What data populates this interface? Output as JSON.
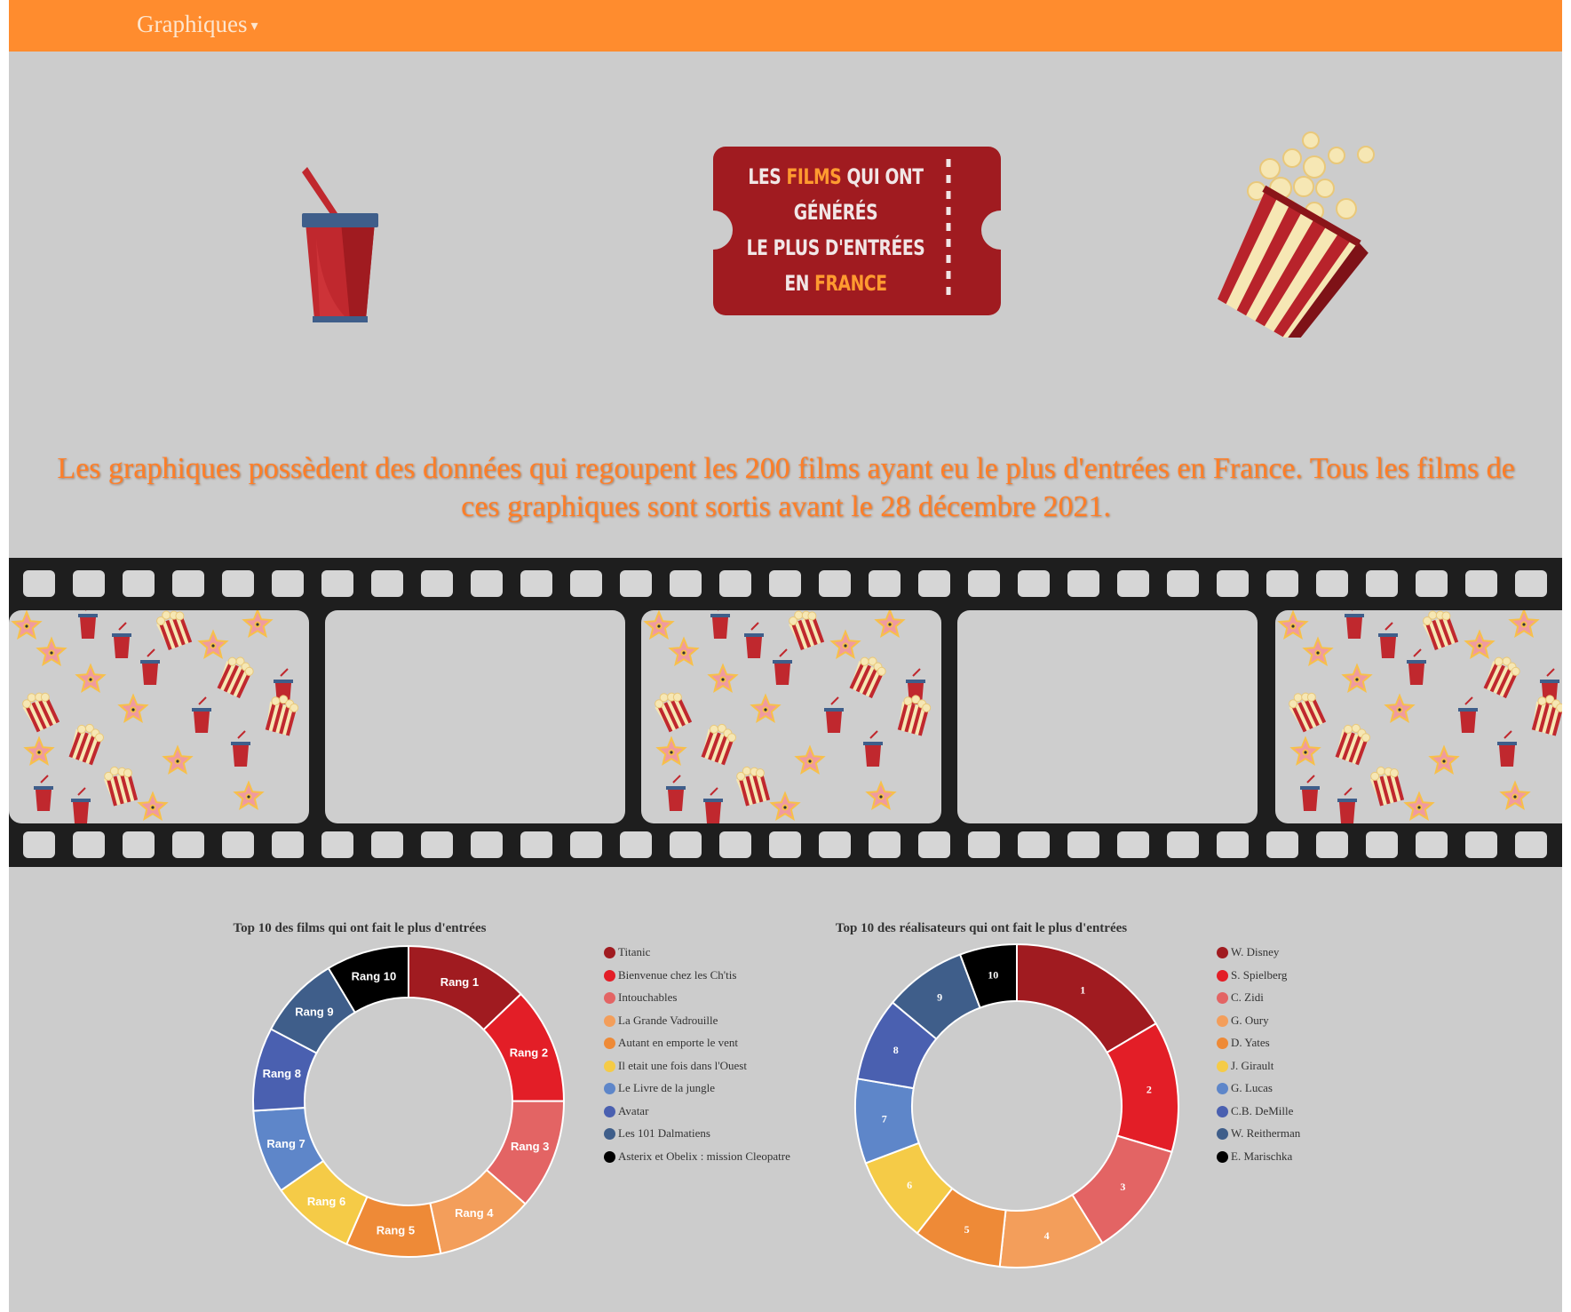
{
  "nav": {
    "menu_label": "Graphiques"
  },
  "ticket": {
    "line1_a": "Les ",
    "line1_hl": "films",
    "line1_b": " qui ont",
    "line2": "générés",
    "line3": "le plus d'entrées",
    "line4_a": "en ",
    "line4_hl": "France"
  },
  "intro": "Les graphiques possèdent des données qui regoupent les 200 films ayant eu le plus d'entrées en France. Tous les films de ces graphiques sont sortis avant le 28 décembre 2021.",
  "colors": {
    "nav": "#ff8c2e",
    "background": "#cccccc",
    "ticket": "#a01b20",
    "highlight": "#ff9b30",
    "palette": [
      "#a01b20",
      "#e31e27",
      "#e36464",
      "#f39e5b",
      "#ee8a37",
      "#f5cb47",
      "#5e86c9",
      "#4a60b0",
      "#3f5e8a",
      "#000000"
    ]
  },
  "chart_data": [
    {
      "type": "pie",
      "title": "Top 10 des films qui ont fait le plus d'entrées",
      "categories": [
        "Titanic",
        "Bienvenue chez les Ch'tis",
        "Intouchables",
        "La Grande Vadrouille",
        "Autant en emporte le vent",
        "Il etait une fois dans l'Ouest",
        "Le Livre de la jungle",
        "Avatar",
        "Les 101 Dalmatiens",
        "Asterix et Obelix : mission Cleopatre"
      ],
      "slice_labels": [
        "Rang 1",
        "Rang 2",
        "Rang 3",
        "Rang 4",
        "Rang 5",
        "Rang 6",
        "Rang 7",
        "Rang 8",
        "Rang 9",
        "Rang 10"
      ],
      "values": [
        21.8,
        20.5,
        19.5,
        17.3,
        16.7,
        14.9,
        14.8,
        14.7,
        14.7,
        14.6
      ],
      "legend_position": "right",
      "donut": true
    },
    {
      "type": "pie",
      "title": "Top 10 des réalisateurs qui ont fait le plus d'entrées",
      "categories": [
        "W. Disney",
        "S. Spielberg",
        "C. Zidi",
        "G. Oury",
        "D. Yates",
        "J. Girault",
        "G. Lucas",
        "C.B. DeMille",
        "W. Reitherman",
        "E. Marischka"
      ],
      "slice_labels": [
        "1",
        "2",
        "3",
        "4",
        "5",
        "6",
        "7",
        "8",
        "9",
        "10"
      ],
      "values": [
        15.6,
        12.4,
        10.9,
        10.0,
        8.4,
        8.2,
        8.0,
        7.9,
        7.8,
        5.4
      ],
      "legend_position": "right",
      "donut": true
    }
  ]
}
